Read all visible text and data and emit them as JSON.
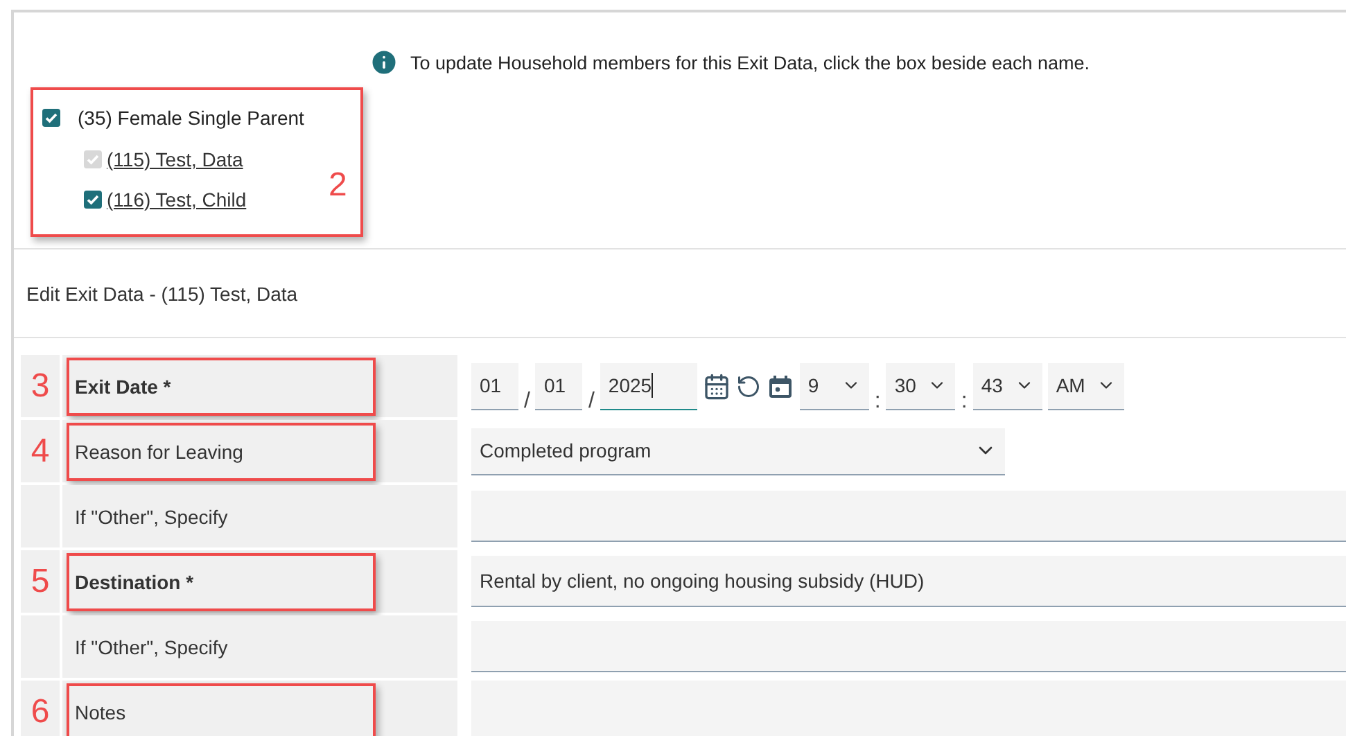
{
  "info_message": "To update Household members for this Exit Data, click the box beside each name.",
  "household": {
    "label": "(35) Female Single Parent",
    "checked": true,
    "annotation": "2",
    "members": [
      {
        "label": "(115) Test, Data",
        "checked": true,
        "disabled": true
      },
      {
        "label": "(116) Test, Child",
        "checked": true,
        "disabled": false
      }
    ]
  },
  "section_title": "Edit Exit Data - (115) Test, Data",
  "rows": [
    {
      "kind": "datetime",
      "annotation": "3",
      "label": "Exit Date",
      "required_mark": "*",
      "date_parts": [
        {
          "value": "01",
          "focused": false
        },
        {
          "value": "01",
          "focused": false
        },
        {
          "value": "2025",
          "focused": true
        }
      ],
      "date_separators": [
        "/",
        "/"
      ],
      "time_parts": [
        {
          "value": "9"
        },
        {
          "value": "30"
        },
        {
          "value": "43"
        },
        {
          "value": "AM"
        }
      ],
      "time_separators": [
        ":",
        ":"
      ]
    },
    {
      "kind": "select",
      "annotation": "4",
      "label": "Reason for Leaving",
      "value": "Completed program"
    },
    {
      "kind": "text",
      "label": "If \"Other\", Specify"
    },
    {
      "kind": "text",
      "annotation": "5",
      "label": "Destination",
      "required_mark": "*",
      "value": "Rental by client, no ongoing housing subsidy (HUD)"
    },
    {
      "kind": "text",
      "label": "If \"Other\", Specify"
    },
    {
      "kind": "textarea",
      "annotation": "6",
      "label": "Notes"
    }
  ]
}
